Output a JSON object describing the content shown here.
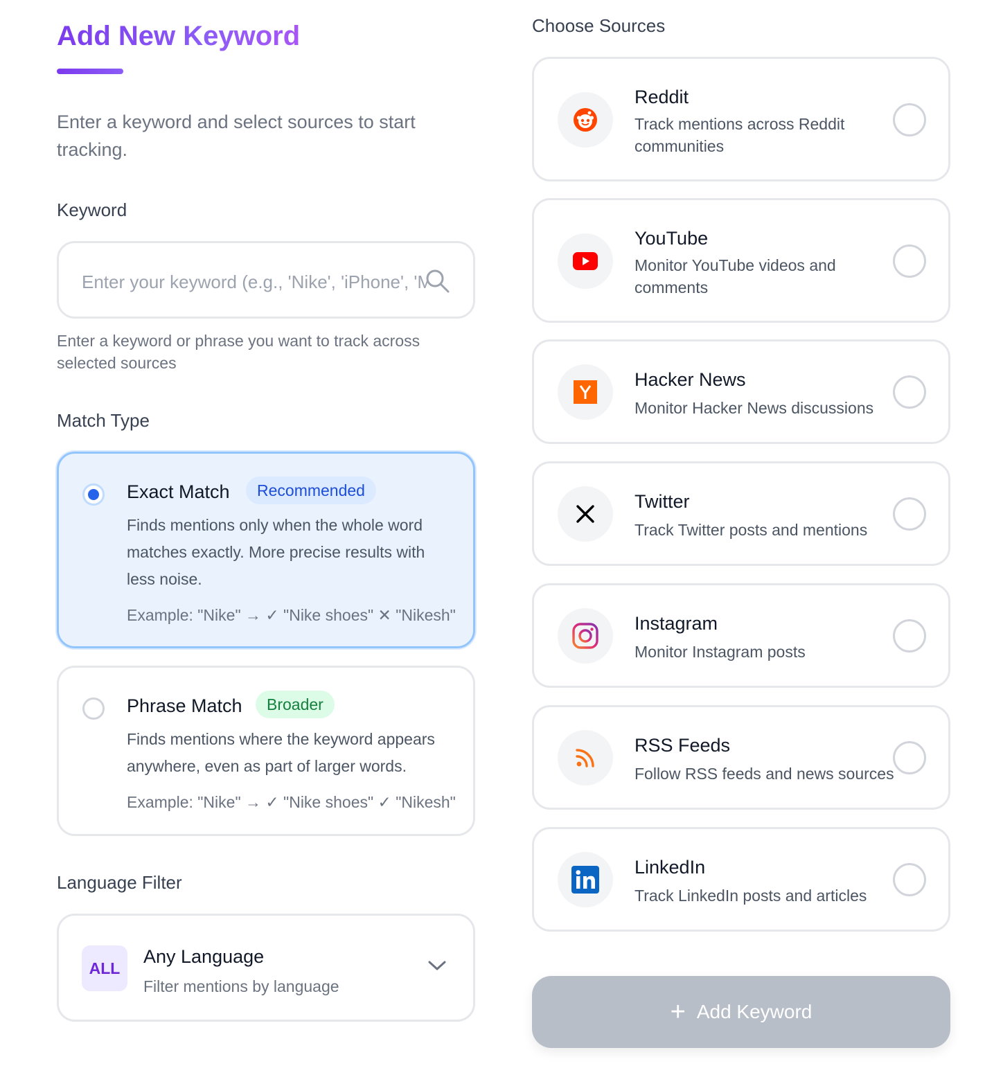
{
  "header": {
    "title": "Add New Keyword",
    "subtitle": "Enter a keyword and select sources to start tracking."
  },
  "keyword": {
    "label": "Keyword",
    "placeholder": "Enter your keyword (e.g., 'Nike', 'iPhone', 'Mac",
    "value": "",
    "helper": "Enter a keyword or phrase you want to track across selected sources"
  },
  "match_type": {
    "label": "Match Type",
    "options": [
      {
        "title": "Exact Match",
        "badge": "Recommended",
        "selected": true,
        "description": "Finds mentions only when the whole word matches exactly. More precise results with less noise.",
        "example": "Example: \"Nike\" → ✓ \"Nike shoes\" ✕ \"Nikesh\""
      },
      {
        "title": "Phrase Match",
        "badge": "Broader",
        "selected": false,
        "description": "Finds mentions where the keyword appears anywhere, even as part of larger words.",
        "example": "Example: \"Nike\" → ✓ \"Nike shoes\" ✓ \"Nikesh\""
      }
    ]
  },
  "language": {
    "label": "Language Filter",
    "badge": "ALL",
    "selected": "Any Language",
    "description": "Filter mentions by language"
  },
  "sources": {
    "label": "Choose Sources",
    "items": [
      {
        "name": "Reddit",
        "description": "Track mentions across Reddit communities",
        "icon": "reddit-icon",
        "color": "#ff4500",
        "selected": false
      },
      {
        "name": "YouTube",
        "description": "Monitor YouTube videos and comments",
        "icon": "youtube-icon",
        "color": "#ff0000",
        "selected": false
      },
      {
        "name": "Hacker News",
        "description": "Monitor Hacker News discussions",
        "icon": "hacker-news-icon",
        "color": "#ff6600",
        "selected": false
      },
      {
        "name": "Twitter",
        "description": "Track Twitter posts and mentions",
        "icon": "x-icon",
        "color": "#000000",
        "selected": false
      },
      {
        "name": "Instagram",
        "description": "Monitor Instagram posts",
        "icon": "instagram-icon",
        "color": "#e1306c",
        "selected": false
      },
      {
        "name": "RSS Feeds",
        "description": "Follow RSS feeds and news sources",
        "icon": "rss-icon",
        "color": "#f97316",
        "selected": false
      },
      {
        "name": "LinkedIn",
        "description": "Track LinkedIn posts and articles",
        "icon": "linkedin-icon",
        "color": "#0a66c2",
        "selected": false
      }
    ]
  },
  "actions": {
    "add_label": "Add Keyword"
  }
}
